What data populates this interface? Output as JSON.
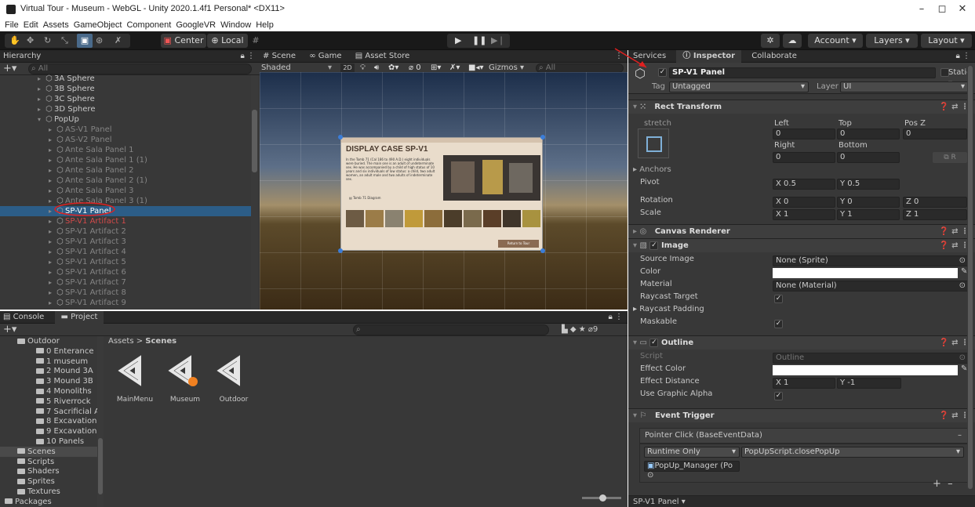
{
  "window": {
    "title": "Virtual Tour - Museum - WebGL - Unity 2020.1.4f1 Personal* <DX11>",
    "min": "–",
    "max": "◻",
    "close": "✕"
  },
  "menu": [
    "File",
    "Edit",
    "Assets",
    "GameObject",
    "Component",
    "GoogleVR",
    "Window",
    "Help"
  ],
  "toolbar": {
    "center": "Center",
    "local": "Local",
    "account": "Account",
    "layers": "Layers",
    "layout": "Layout"
  },
  "hierarchy": {
    "title": "Hierarchy",
    "search": "All",
    "items": [
      {
        "label": "3A Sphere",
        "indent": 1,
        "state": "normal"
      },
      {
        "label": "3B Sphere",
        "indent": 1,
        "state": "normal"
      },
      {
        "label": "3C Sphere",
        "indent": 1,
        "state": "normal"
      },
      {
        "label": "3D Sphere",
        "indent": 1,
        "state": "normal"
      },
      {
        "label": "PopUp",
        "indent": 1,
        "state": "normal",
        "open": true
      },
      {
        "label": "AS-V1 Panel",
        "indent": 2,
        "state": "dim"
      },
      {
        "label": "AS-V2 Panel",
        "indent": 2,
        "state": "dim"
      },
      {
        "label": "Ante Sala Panel 1",
        "indent": 2,
        "state": "dim"
      },
      {
        "label": "Ante Sala Panel 1 (1)",
        "indent": 2,
        "state": "dim"
      },
      {
        "label": "Ante Sala Panel 2",
        "indent": 2,
        "state": "dim"
      },
      {
        "label": "Ante Sala Panel 2 (1)",
        "indent": 2,
        "state": "dim"
      },
      {
        "label": "Ante Sala Panel 3",
        "indent": 2,
        "state": "dim"
      },
      {
        "label": "Ante Sala Panel 3 (1)",
        "indent": 2,
        "state": "dim"
      },
      {
        "label": "SP-V1 Panel",
        "indent": 2,
        "state": "selected"
      },
      {
        "label": "SP-V1 Artifact 1",
        "indent": 2,
        "state": "red"
      },
      {
        "label": "SP-V1 Artifact 2",
        "indent": 2,
        "state": "dim"
      },
      {
        "label": "SP-V1 Artifact 3",
        "indent": 2,
        "state": "dim"
      },
      {
        "label": "SP-V1 Artifact 4",
        "indent": 2,
        "state": "dim"
      },
      {
        "label": "SP-V1 Artifact 5",
        "indent": 2,
        "state": "dim"
      },
      {
        "label": "SP-V1 Artifact 6",
        "indent": 2,
        "state": "dim"
      },
      {
        "label": "SP-V1 Artifact 7",
        "indent": 2,
        "state": "dim"
      },
      {
        "label": "SP-V1 Artifact 8",
        "indent": 2,
        "state": "dim"
      },
      {
        "label": "SP-V1 Artifact 9",
        "indent": 2,
        "state": "dim"
      }
    ]
  },
  "scene": {
    "tabs": [
      "Scene",
      "Game",
      "Asset Store"
    ],
    "shaded": "Shaded",
    "mode2d": "2D",
    "gizmos": "Gizmos",
    "search": "All",
    "hidden_count": "0",
    "popup": {
      "title": "DISPLAY CASE SP-V1",
      "body": "In the Tomb 71 (Cal 186 to 490 A.D.) eight individuals were buried. The main one is an adult of undeterminate sex. He was accompanied by a child of high status of 10 years and six individuals of low status: a child, two adult women, an adult male and two adults of indeterminate sex.",
      "caption": "Tomb 71 Diagram",
      "button": "Return to Tour"
    }
  },
  "console": {
    "tab_console": "Console",
    "tab_project": "Project",
    "hidden_count": "9",
    "folders": [
      "Outdoor",
      "0 Enterance",
      "1 museum",
      "2 Mound 3A",
      "3 Mound 3B",
      "4 Monoliths",
      "5 Riverrock",
      "7 Sacrificial A",
      "8 Excavation",
      "9 Excavation",
      "10 Panels",
      "Scenes",
      "Scripts",
      "Shaders",
      "Sprites",
      "Textures",
      "Packages"
    ],
    "breadcrumb": [
      "Assets",
      "Scenes"
    ],
    "assets": [
      "MainMenu",
      "Museum",
      "Outdoor"
    ]
  },
  "inspector": {
    "tabs": [
      "Services",
      "Inspector",
      "Collaborate"
    ],
    "name": "SP-V1 Panel",
    "static": "Static",
    "tag_label": "Tag",
    "tag": "Untagged",
    "layer_label": "Layer",
    "layer": "UI",
    "rect": {
      "title": "Rect Transform",
      "stretch": "stretch",
      "left_label": "Left",
      "top_label": "Top",
      "posz_label": "Pos Z",
      "left": "0",
      "top": "0",
      "posz": "0",
      "right_label": "Right",
      "bottom_label": "Bottom",
      "right": "0",
      "bottom": "0",
      "anchors": "Anchors",
      "pivot": "Pivot",
      "pivot_x": "0.5",
      "pivot_y": "0.5",
      "rotation": "Rotation",
      "rot_x": "0",
      "rot_y": "0",
      "rot_z": "0",
      "scale": "Scale",
      "sc_x": "1",
      "sc_y": "1",
      "sc_z": "1",
      "r_btn": "R"
    },
    "canvas_renderer": "Canvas Renderer",
    "image": {
      "title": "Image",
      "source_label": "Source Image",
      "source": "None (Sprite)",
      "color_label": "Color",
      "material_label": "Material",
      "material": "None (Material)",
      "raycast_target": "Raycast Target",
      "raycast_padding": "Raycast Padding",
      "maskable": "Maskable"
    },
    "outline": {
      "title": "Outline",
      "script_label": "Script",
      "script": "Outline",
      "effect_color": "Effect Color",
      "effect_distance": "Effect Distance",
      "dx": "1",
      "dy": "-1",
      "use_alpha": "Use Graphic Alpha"
    },
    "event": {
      "title": "Event Trigger",
      "entry": "Pointer Click (BaseEventData)",
      "runtime": "Runtime Only",
      "func": "PopUpScript.closePopUp",
      "obj": "PopUp_Manager (Po"
    },
    "footer": "SP-V1 Panel"
  },
  "axis": {
    "x": "X",
    "y": "Y",
    "z": "Z"
  },
  "colors": {
    "selection": "#2c5d87",
    "annotation": "#e02020"
  }
}
